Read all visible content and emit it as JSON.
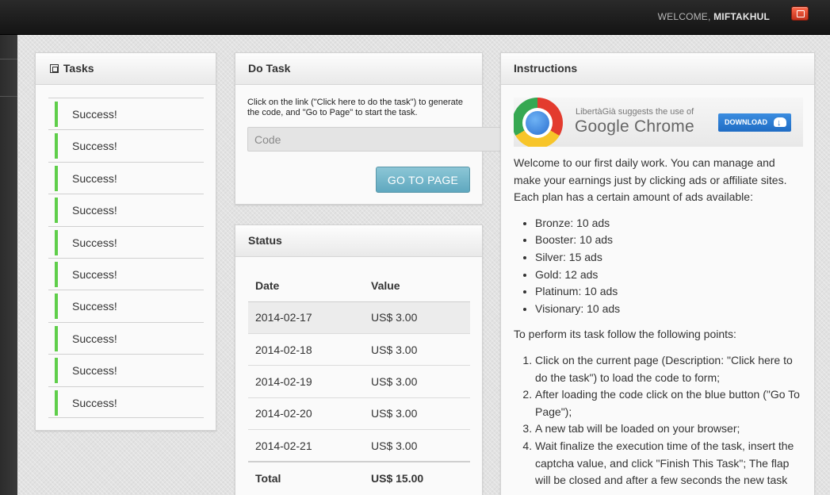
{
  "header": {
    "welcome_label": "WELCOME,",
    "username": "MIFTAKHUL"
  },
  "tasks": {
    "title": "Tasks",
    "items": [
      "Success!",
      "Success!",
      "Success!",
      "Success!",
      "Success!",
      "Success!",
      "Success!",
      "Success!",
      "Success!",
      "Success!"
    ]
  },
  "do_task": {
    "title": "Do Task",
    "instructions": "Click on the link (\"Click here to do the task\") to generate the code, and \"Go to Page\" to start the task.",
    "code_placeholder": "Code",
    "go_button_label": "GO TO PAGE"
  },
  "status": {
    "title": "Status",
    "columns": [
      "Date",
      "Value"
    ],
    "rows": [
      {
        "date": "2014-02-17",
        "value": "US$ 3.00"
      },
      {
        "date": "2014-02-18",
        "value": "US$ 3.00"
      },
      {
        "date": "2014-02-19",
        "value": "US$ 3.00"
      },
      {
        "date": "2014-02-20",
        "value": "US$ 3.00"
      },
      {
        "date": "2014-02-21",
        "value": "US$ 3.00"
      }
    ],
    "total_label": "Total",
    "total_value": "US$ 15.00"
  },
  "instructions": {
    "title": "Instructions",
    "banner": {
      "suggest": "LibertàGià suggests the use of",
      "brand": "Google Chrome",
      "download_label": "DOWNLOAD"
    },
    "intro": "Welcome to our first daily work. You can manage and make your earnings just by clicking ads or affiliate sites. Each plan has a certain amount of ads available:",
    "plans": [
      "Bronze: 10 ads",
      "Booster: 10 ads",
      "Silver: 15 ads",
      "Gold: 12 ads",
      "Platinum: 10 ads",
      "Visionary: 10 ads"
    ],
    "steps_intro": "To perform its task follow the following points:",
    "steps": [
      "Click on the current page (Description: \"Click here to do the task\") to load the code to form;",
      "After loading the code click on the blue button (\"Go To Page\");",
      "A new tab will be loaded on your browser;",
      "Wait finalize the execution time of the task, insert the captcha value, and click \"Finish This Task\"; The flap will be closed and after a few seconds the new task"
    ]
  }
}
